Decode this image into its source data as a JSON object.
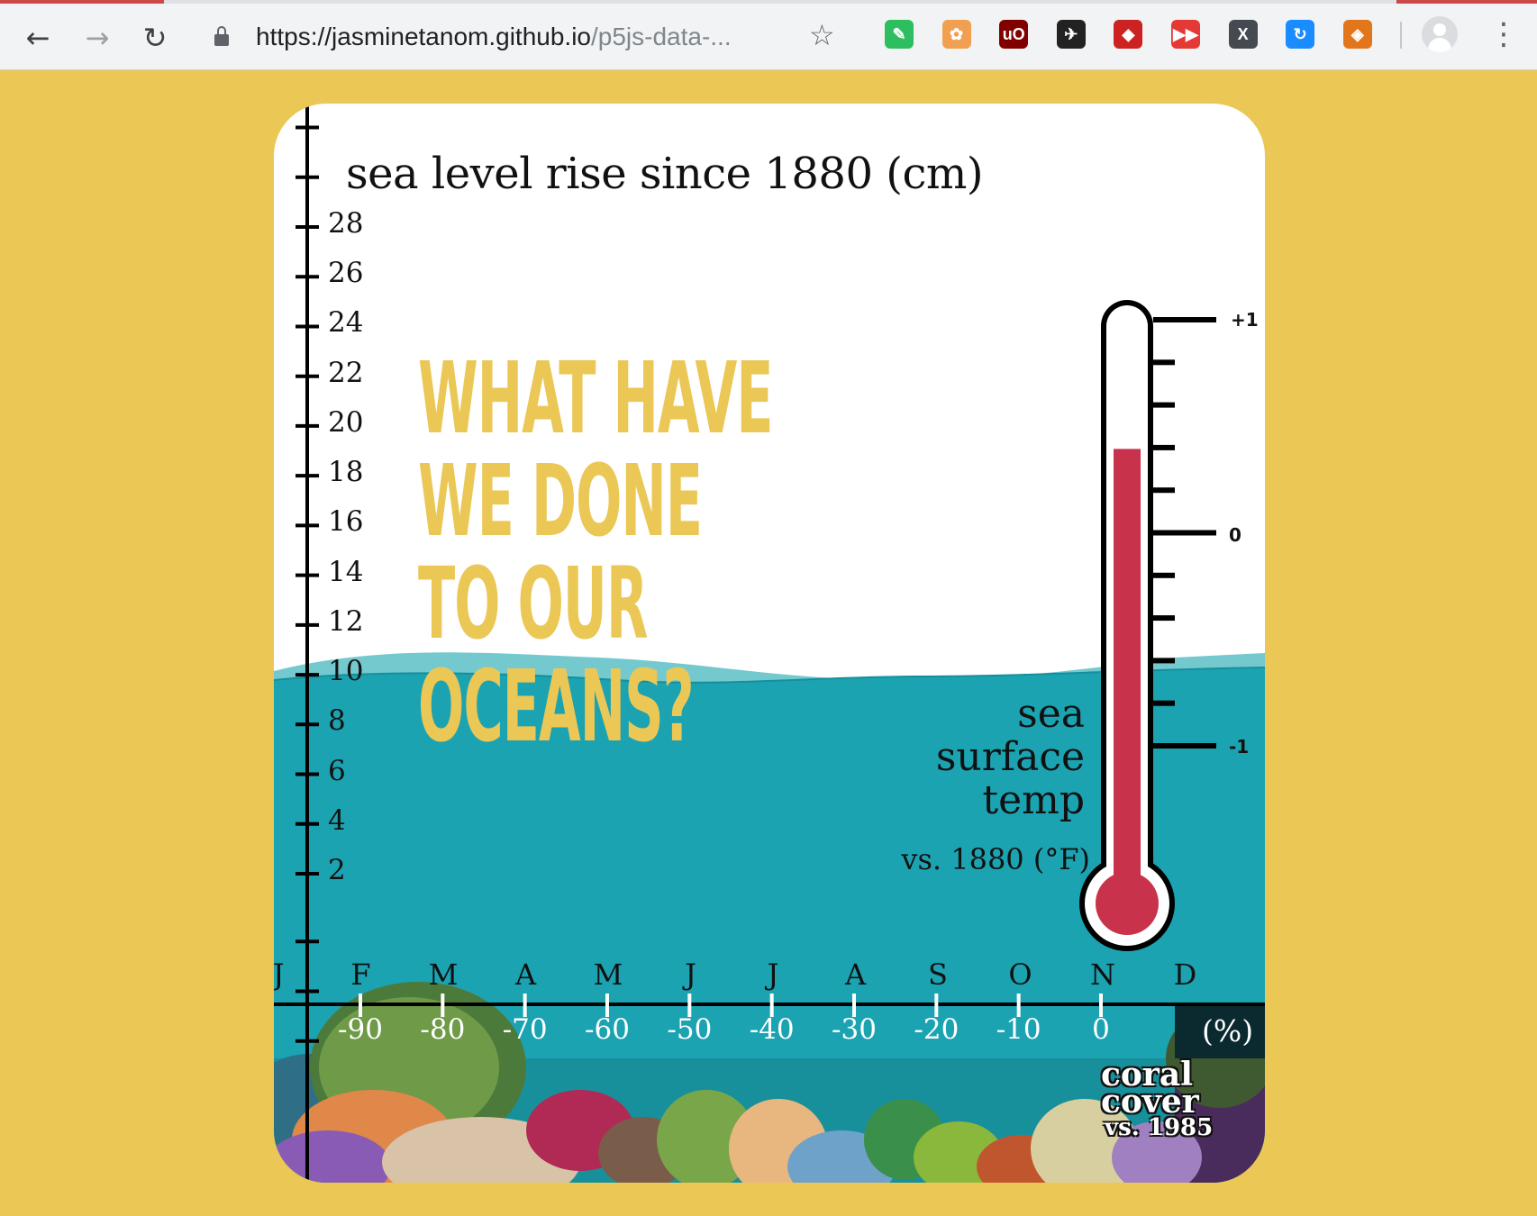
{
  "browser": {
    "url_main": "https://jasminetanom.github.io",
    "url_path": "/p5js-data-...",
    "extensions": [
      {
        "name": "evernote-icon",
        "color": "#2dbe60",
        "glyph": "✎"
      },
      {
        "name": "fox-extension-icon",
        "color": "#f0a050",
        "glyph": "✿"
      },
      {
        "name": "ublock-icon",
        "color": "#800000",
        "glyph": "uO"
      },
      {
        "name": "penguin-extension-icon",
        "color": "#222222",
        "glyph": "✈"
      },
      {
        "name": "ruby-icon",
        "color": "#cc2222",
        "glyph": "◆"
      },
      {
        "name": "video-speed-icon",
        "color": "#e53935",
        "glyph": "▶▶"
      },
      {
        "name": "x-extension-icon",
        "color": "#444a50",
        "glyph": "X"
      },
      {
        "name": "sync-extension-icon",
        "color": "#1a8cff",
        "glyph": "↻"
      },
      {
        "name": "metamask-icon",
        "color": "#e2761b",
        "glyph": "◈"
      }
    ]
  },
  "sketch": {
    "title": "sea level rise since 1880 (cm)",
    "headline": [
      "WHAT HAVE",
      "WE DONE",
      "TO OUR",
      "OCEANS?"
    ],
    "sea_level_ticks": [
      "28",
      "26",
      "24",
      "22",
      "20",
      "18",
      "16",
      "14",
      "12",
      "10",
      "8",
      "6",
      "4",
      "2"
    ],
    "months": [
      "J",
      "F",
      "M",
      "A",
      "M",
      "J",
      "J",
      "A",
      "S",
      "O",
      "N",
      "D"
    ],
    "coral_ticks": [
      "-90",
      "-80",
      "-70",
      "-60",
      "-50",
      "-40",
      "-30",
      "-20",
      "-10",
      "0"
    ],
    "coral_unit": "(%)",
    "thermometer": {
      "label_line1": "sea",
      "label_line2": "surface",
      "label_line3": "temp",
      "label_line4": "vs. 1880 (°F)",
      "tick_plus": "+1",
      "tick_zero": "0",
      "tick_minus": "-1",
      "reading_f": 0.4,
      "mercury_color": "#c8324a"
    },
    "coral_label": [
      "coral",
      "cover",
      "vs. 1985"
    ],
    "colors": {
      "background": "#ebc755",
      "ocean": "#1ba3b2",
      "wave_light": "#74c9cf",
      "headline": "#ebc755"
    }
  }
}
